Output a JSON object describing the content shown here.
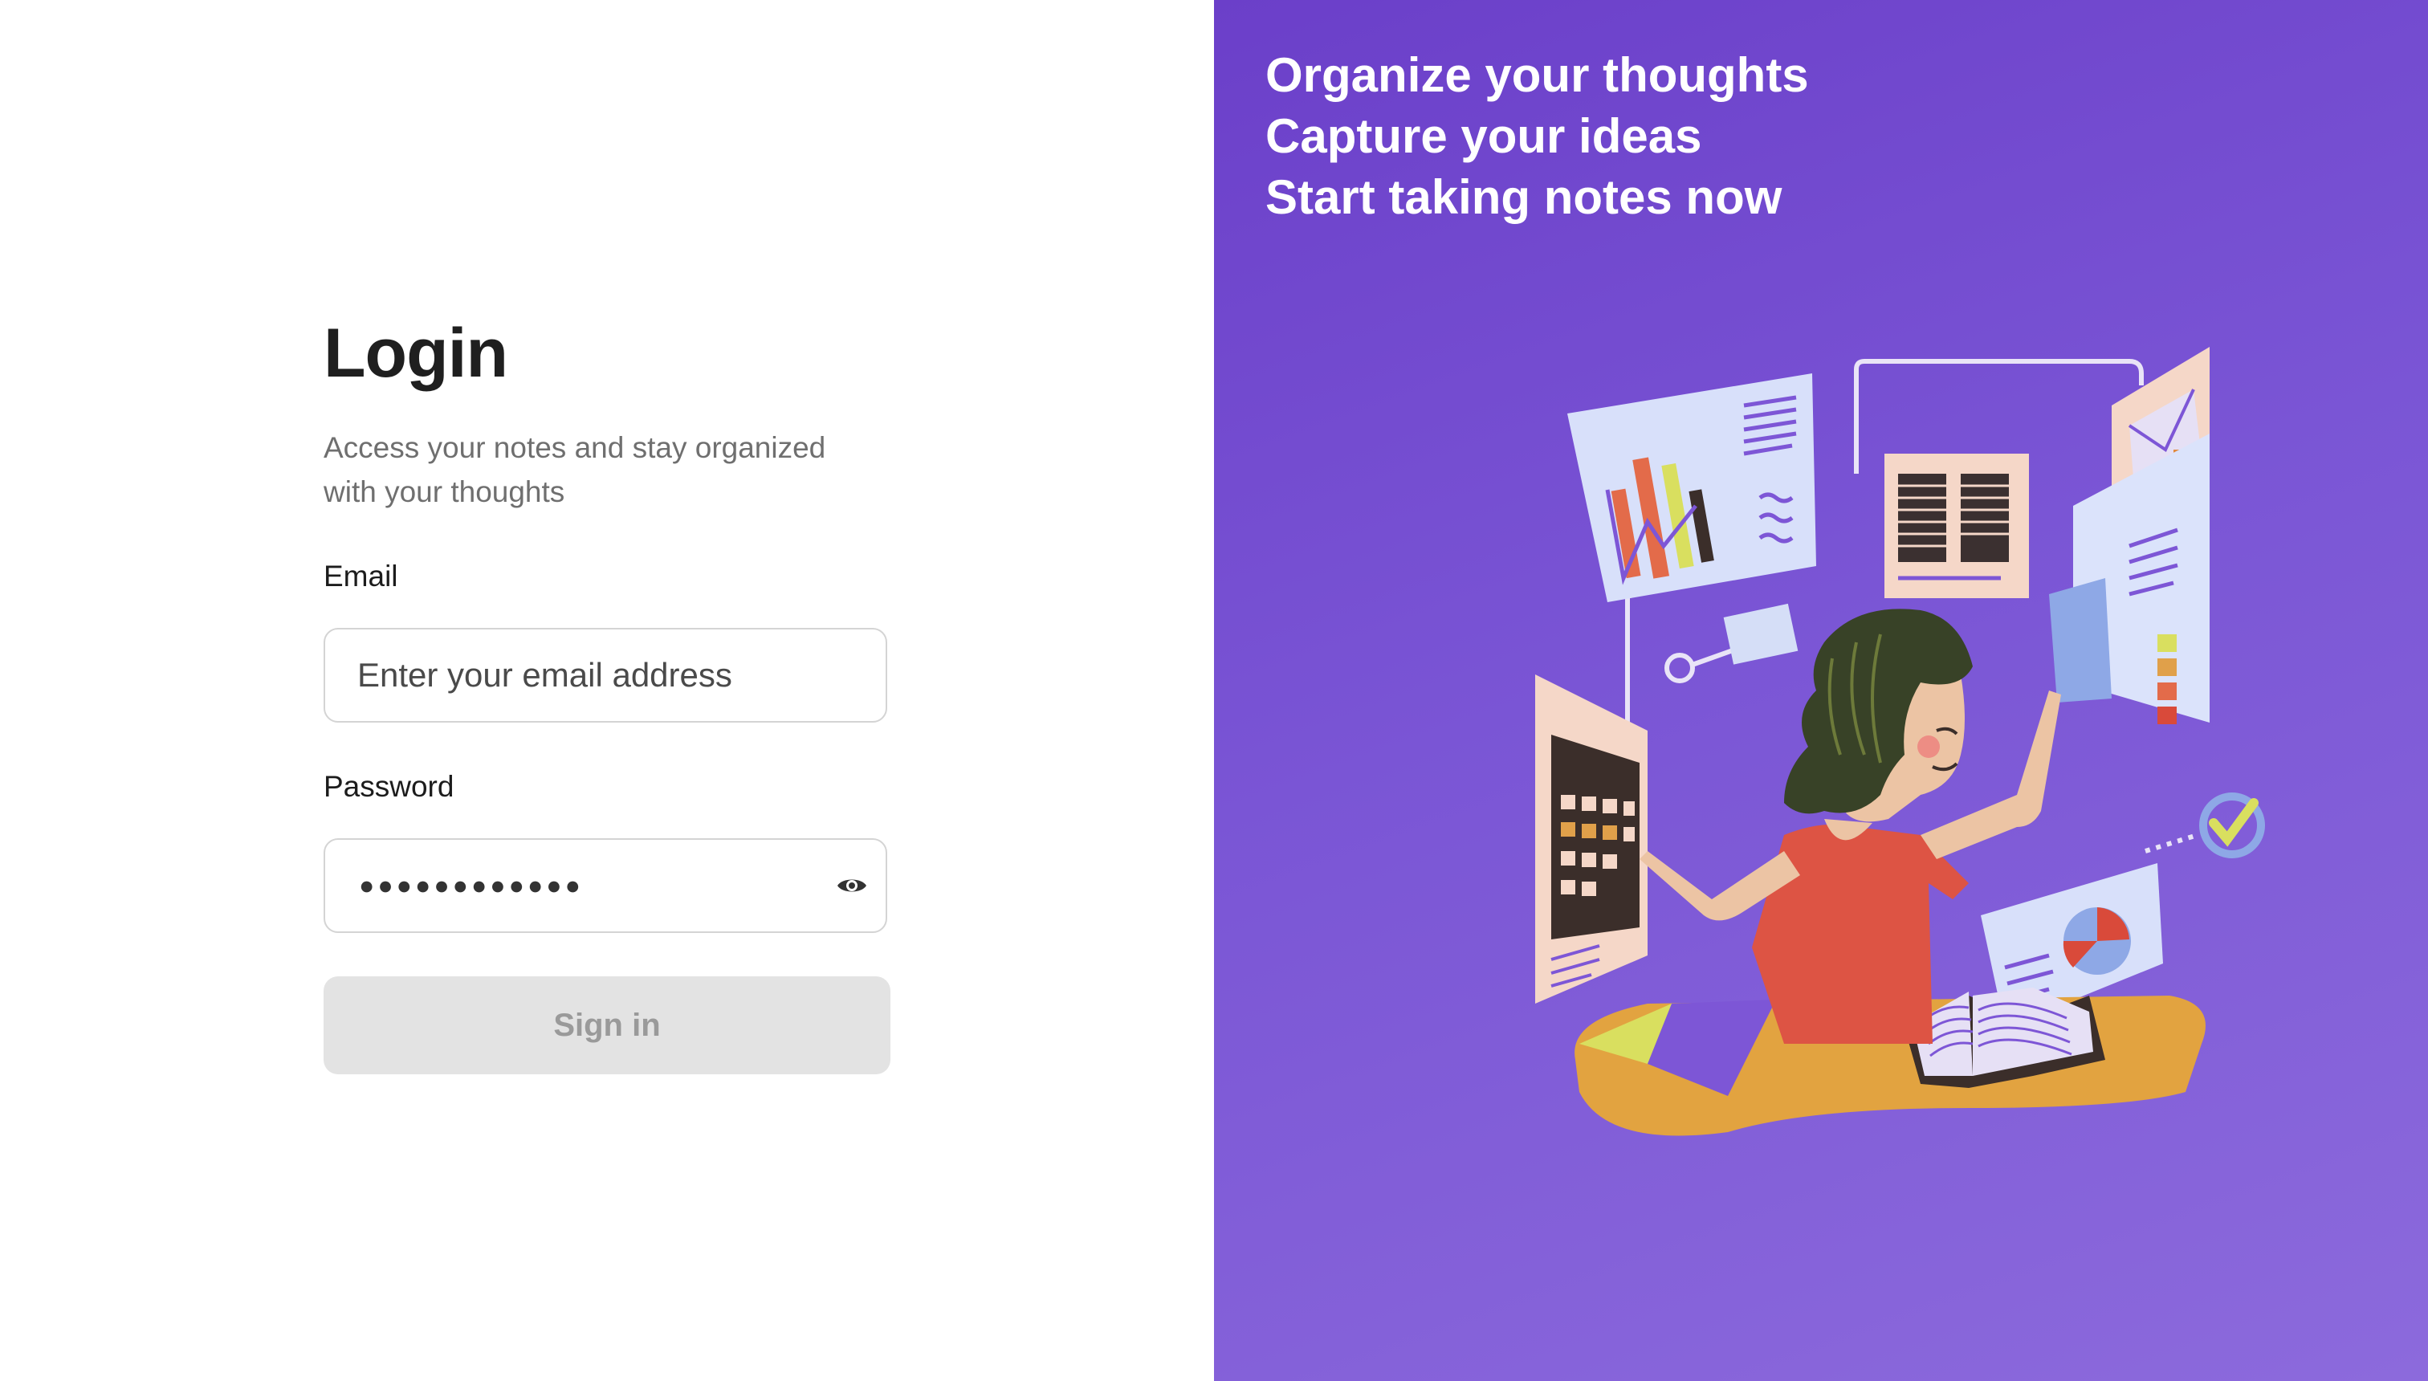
{
  "login": {
    "title": "Login",
    "subtitle": "Access your notes and stay organized with your thoughts",
    "email_label": "Email",
    "email_placeholder": "Enter your email address",
    "password_label": "Password",
    "password_mask": "●●●●●●●●●●●●",
    "submit_label": "Sign in"
  },
  "hero": {
    "lines": [
      "Organize your thoughts",
      "Capture your ideas",
      "Start taking notes now"
    ],
    "illustration": "woman-organizing-notes-illustration"
  },
  "colors": {
    "accent": "#7445d1",
    "button_disabled_bg": "#e3e3e3",
    "button_disabled_text": "#9a9a9a"
  }
}
